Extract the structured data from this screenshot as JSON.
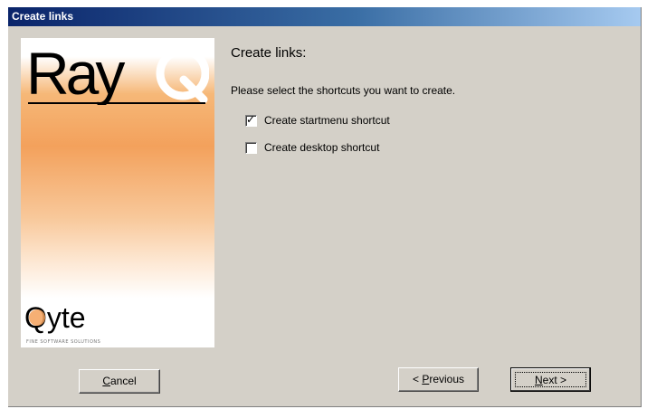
{
  "window": {
    "title": "Create links"
  },
  "banner": {
    "product_logo": "RayQ",
    "company_logo": "Qyte",
    "company_tagline": "FINE SOFTWARE SOLUTIONS"
  },
  "content": {
    "heading": "Create links:",
    "prompt": "Please select the shortcuts you want to create.",
    "options": [
      {
        "label": "Create startmenu shortcut",
        "checked": true
      },
      {
        "label": "Create desktop shortcut",
        "checked": false
      }
    ]
  },
  "buttons": {
    "cancel": {
      "first": "C",
      "rest": "ancel"
    },
    "previous": {
      "prefix": "< ",
      "first": "P",
      "rest": "revious"
    },
    "next": {
      "first": "N",
      "rest": "ext >"
    }
  }
}
